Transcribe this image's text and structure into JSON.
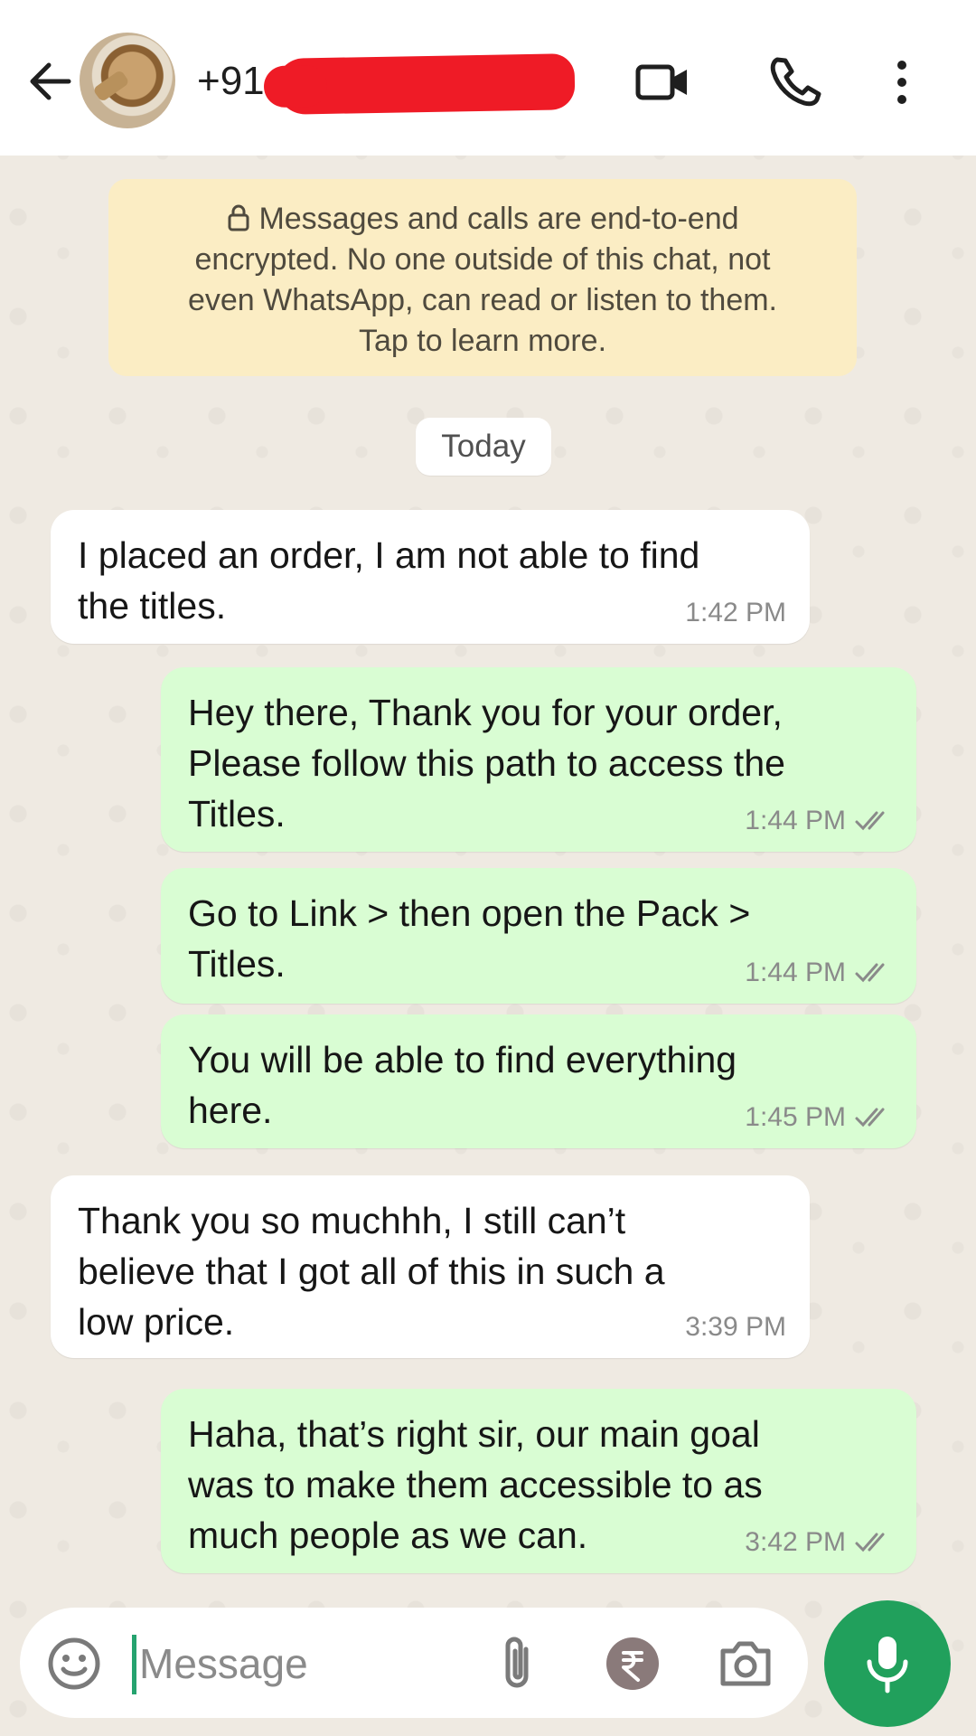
{
  "header": {
    "contact_number": "+91",
    "icons": [
      "back-arrow-icon",
      "avatar",
      "video-call-icon",
      "phone-icon",
      "more-vert-icon"
    ]
  },
  "encryption_notice": {
    "lines": [
      "Messages and calls are end-to-end",
      "encrypted. No one outside of this chat, not",
      "even WhatsApp, can read or listen to them.",
      "Tap to learn more."
    ]
  },
  "date_chip": "Today",
  "messages": [
    {
      "direction": "in",
      "text": "I placed an order, I am not able to find\nthe titles.",
      "time": "1:42 PM"
    },
    {
      "direction": "out",
      "text": "Hey there, Thank you for your order,\nPlease follow this path to access the\nTitles.",
      "time": "1:44 PM",
      "status": "read"
    },
    {
      "direction": "out",
      "text": "Go to Link > then open the Pack >\nTitles.",
      "time": "1:44 PM",
      "status": "read"
    },
    {
      "direction": "out",
      "text": "You will be able to find everything\nhere.",
      "time": "1:45 PM",
      "status": "read"
    },
    {
      "direction": "in",
      "text": "Thank you so muchhh, I still can’t\nbelieve that I got all of this in such a\nlow price.",
      "time": "3:39 PM"
    },
    {
      "direction": "out",
      "text": "Haha, that’s right sir, our main goal\nwas to make them accessible to as\nmuch people as we can.",
      "time": "3:42 PM",
      "status": "read"
    }
  ],
  "input": {
    "placeholder": "Message",
    "icons": [
      "emoji-icon",
      "attach-icon",
      "rupee-icon",
      "camera-icon",
      "mic-icon"
    ]
  },
  "colors": {
    "chat_background": "#efeae2",
    "incoming_bubble": "#ffffff",
    "outgoing_bubble": "#d9fdd3",
    "notice_background": "#fbedc4",
    "mic_button": "#21a05c",
    "redaction": "#ef1b26"
  }
}
